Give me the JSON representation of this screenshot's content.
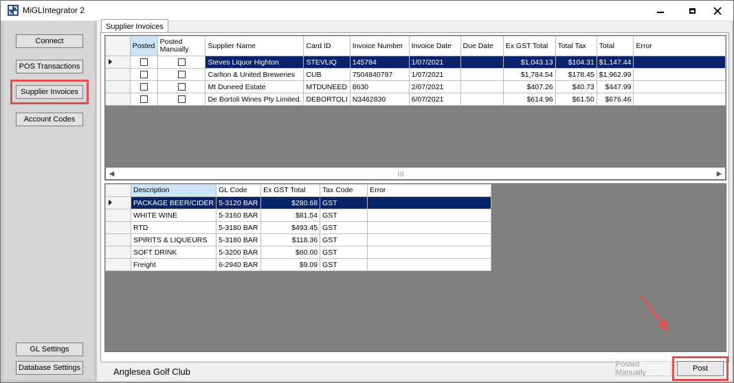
{
  "window": {
    "title": "MiGLIntegrator 2"
  },
  "sidebar": {
    "connect": "Connect",
    "pos_transactions": "POS Transactions",
    "supplier_invoices": "Supplier Invoices",
    "account_codes": "Account Codes",
    "gl_settings": "GL Settings",
    "database_settings": "Database Settings"
  },
  "tab": {
    "label": "Supplier Invoices"
  },
  "invoices": {
    "headers": {
      "posted": "Posted",
      "posted_manually": "Posted Manually",
      "supplier_name": "Supplier Name",
      "card_id": "Card ID",
      "invoice_number": "Invoice Number",
      "invoice_date": "Invoice Date",
      "due_date": "Due Date",
      "ex_gst_total": "Ex GST Total",
      "total_tax": "Total Tax",
      "total": "Total",
      "error": "Error"
    },
    "rows": [
      {
        "supplier": "Steves Liquor Highton",
        "card": "STEVLIQ",
        "invoice": "145784",
        "date": "1/07/2021",
        "due": "",
        "ex_gst": "$1,043.13",
        "tax": "$104.31",
        "total": "$1,147.44",
        "error": ""
      },
      {
        "supplier": "Carlton & United Breweries",
        "card": "CUB",
        "invoice": "7504840797",
        "date": "1/07/2021",
        "due": "",
        "ex_gst": "$1,784.54",
        "tax": "$178.45",
        "total": "$1,962.99",
        "error": ""
      },
      {
        "supplier": "Mt Duneed Estate",
        "card": "MTDUNEED",
        "invoice": "8630",
        "date": "2/07/2021",
        "due": "",
        "ex_gst": "$407.26",
        "tax": "$40.73",
        "total": "$447.99",
        "error": ""
      },
      {
        "supplier": "De Bortoli Wines Pty Limited.",
        "card": "DEBORTOLI",
        "invoice": "N3462830",
        "date": "6/07/2021",
        "due": "",
        "ex_gst": "$614.96",
        "tax": "$61.50",
        "total": "$676.46",
        "error": ""
      }
    ]
  },
  "lines": {
    "headers": {
      "description": "Description",
      "gl_code": "GL Code",
      "ex_gst_total": "Ex GST Total",
      "tax_code": "Tax Code",
      "error": "Error"
    },
    "rows": [
      {
        "description": "PACKAGE BEER/CIDER",
        "gl": "5-3120 BAR",
        "ex_gst": "$280.68",
        "tax": "GST",
        "error": ""
      },
      {
        "description": "WHITE WINE",
        "gl": "5-3160 BAR",
        "ex_gst": "$81.54",
        "tax": "GST",
        "error": ""
      },
      {
        "description": "RTD",
        "gl": "5-3180 BAR",
        "ex_gst": "$493.45",
        "tax": "GST",
        "error": ""
      },
      {
        "description": "SPIRITS & LIQUEURS",
        "gl": "5-3180 BAR",
        "ex_gst": "$118.36",
        "tax": "GST",
        "error": ""
      },
      {
        "description": "SOFT DRINK",
        "gl": "5-3200 BAR",
        "ex_gst": "$60.00",
        "tax": "GST",
        "error": ""
      },
      {
        "description": "Freight",
        "gl": "6-2940 BAR",
        "ex_gst": "$9.09",
        "tax": "GST",
        "error": ""
      }
    ]
  },
  "footer": {
    "club_name": "Anglesea Golf Club",
    "posted_manually": "Posted Manually",
    "post": "Post"
  },
  "colors": {
    "selection": "#0a246a",
    "highlight": "#e05050",
    "grid_background": "#808080"
  }
}
